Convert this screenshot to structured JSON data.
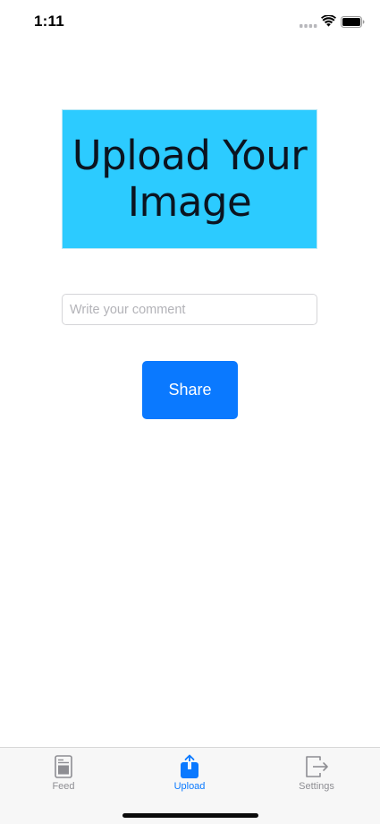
{
  "status_bar": {
    "time": "1:11"
  },
  "upload": {
    "image_text": "Upload Your Image",
    "background_color": "#2ccbff"
  },
  "comment": {
    "placeholder": "Write your comment",
    "value": ""
  },
  "share": {
    "label": "Share",
    "color": "#0a79ff"
  },
  "tab_bar": {
    "active_color": "#0a79ff",
    "inactive_color": "#8e8e93",
    "tabs": [
      {
        "label": "Feed",
        "icon": "feed-document-icon",
        "active": false
      },
      {
        "label": "Upload",
        "icon": "upload-share-icon",
        "active": true
      },
      {
        "label": "Settings",
        "icon": "sign-out-icon",
        "active": false
      }
    ]
  }
}
